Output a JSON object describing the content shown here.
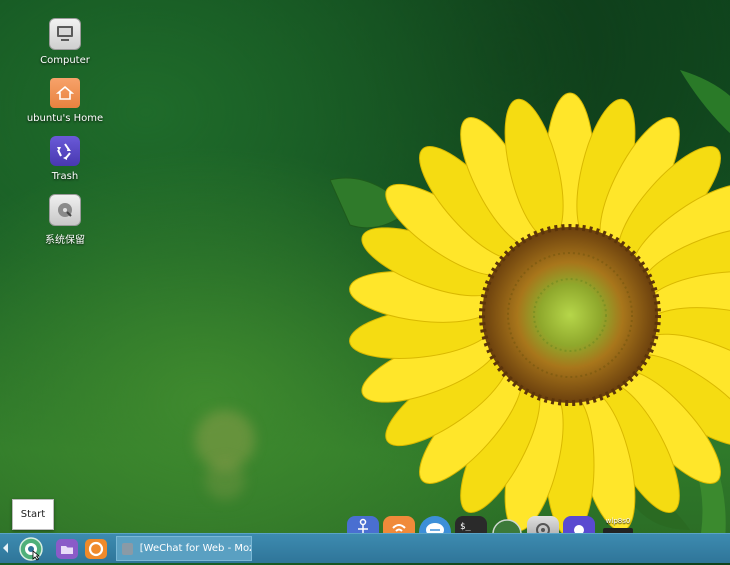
{
  "desktop": {
    "icons": [
      {
        "label": "Computer",
        "icon": "computer-icon"
      },
      {
        "label": "ubuntu's Home",
        "icon": "home-folder-icon"
      },
      {
        "label": "Trash",
        "icon": "trash-icon"
      },
      {
        "label": "系统保留",
        "icon": "disk-icon"
      }
    ]
  },
  "tooltip": {
    "text": "Start"
  },
  "dock": {
    "items": [
      "anchor-icon",
      "feed-icon",
      "chat-icon",
      "terminal-icon",
      "globe-icon",
      "settings-icon",
      "app-icon"
    ],
    "tray_label": "wlp8s0"
  },
  "taskbar": {
    "start_icon": "start-menu-icon",
    "launchers": [
      "file-manager-icon",
      "browser-icon"
    ],
    "window_title": "[WeChat for Web - Moz..."
  },
  "colors": {
    "taskbar": "#3780a5",
    "accent": "#4fb07a"
  }
}
